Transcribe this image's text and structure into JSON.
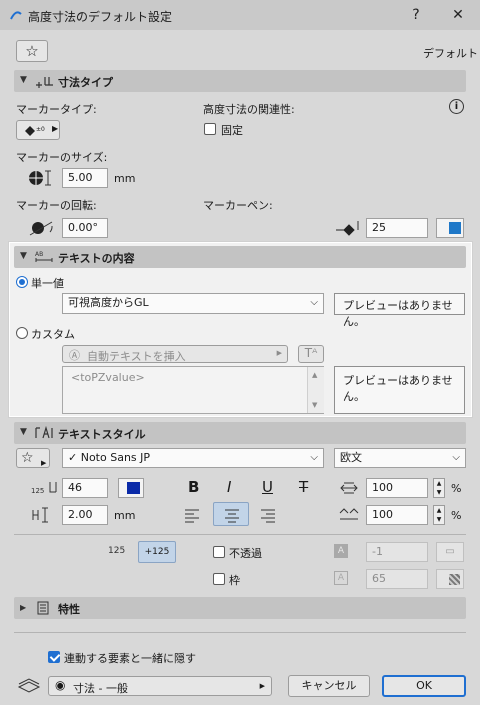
{
  "window": {
    "title": "高度寸法のデフォルト設定",
    "help_label": "?",
    "close_label": "✕"
  },
  "toolbar": {
    "favorite_label": "☆",
    "default_label": "デフォルト"
  },
  "dimension_type": {
    "header": "寸法タイプ",
    "marker_type_label": "マーカータイプ:",
    "associativity_label": "高度寸法の関連性:",
    "fixed_label": "固定",
    "fixed_checked": false,
    "marker_size_label": "マーカーのサイズ:",
    "marker_size_value": "5.00",
    "marker_size_unit": "mm",
    "marker_rotation_label": "マーカーの回転:",
    "marker_rotation_value": "0.00°",
    "marker_pen_label": "マーカーペン:",
    "marker_pen_value": "25",
    "marker_pen_color": "#1f78c8"
  },
  "text_content": {
    "header": "テキストの内容",
    "single_value_label": "単一値",
    "single_value_selected": true,
    "single_value_dropdown": "可視高度からGL",
    "preview_text_1": "プレビューはありません。",
    "custom_label": "カスタム",
    "auto_text_label": "自動テキストを挿入",
    "custom_text_value": "<toPZvalue>",
    "preview_text_2": "プレビューはありません。"
  },
  "text_style": {
    "header": "テキストスタイル",
    "font_name": "Noto Sans JP",
    "script_value": "欧文",
    "pen_value": "46",
    "pen_color": "#0a2aa8",
    "bold_label": "B",
    "italic_label": "I",
    "underline_label": "U",
    "strike_label": "T",
    "width_value": "100",
    "width_unit": "%",
    "size_value": "2.00",
    "size_unit": "mm",
    "spacing_value": "100",
    "spacing_unit": "%",
    "size_icon_label": "125",
    "scale_label": "125",
    "scale_plus_label": "+125",
    "opaque_label": "不透過",
    "opaque_checked": false,
    "opaque_value": "-1",
    "frame_label": "枠",
    "frame_checked": false,
    "frame_value": "65"
  },
  "properties": {
    "header": "特性"
  },
  "footer": {
    "hide_with_linked_label": "連動する要素と一緒に隠す",
    "hide_with_linked_checked": true,
    "layer_value": "寸法 - 一般",
    "cancel_label": "キャンセル",
    "ok_label": "OK"
  },
  "colors": {
    "accent": "#1f6fd1"
  }
}
